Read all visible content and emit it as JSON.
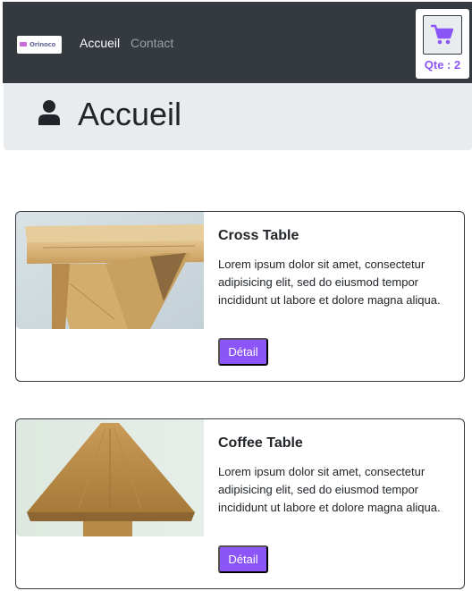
{
  "navbar": {
    "logo_text": "Orinoco",
    "links": [
      {
        "label": "Accueil",
        "active": true
      },
      {
        "label": "Contact",
        "active": false
      }
    ],
    "cart": {
      "icon": "shopping-cart-icon",
      "quantity_label": "Qte : 2",
      "quantity": 2
    }
  },
  "header": {
    "icon": "user-icon",
    "title": "Accueil"
  },
  "products": [
    {
      "name": "Cross Table",
      "description": "Lorem ipsum dolor sit amet, consectetur adipisicing elit, sed do eiusmod tempor incididunt ut labore et dolore magna aliqua.",
      "button_label": "Détail"
    },
    {
      "name": "Coffee Table",
      "description": "Lorem ipsum dolor sit amet, consectetur adipisicing elit, sed do eiusmod tempor incididunt ut labore et dolore magna aliqua.",
      "button_label": "Détail"
    }
  ],
  "colors": {
    "navbar_bg": "#343a40",
    "accent": "#8c55f7",
    "jumbotron_bg": "#e9ecef"
  }
}
